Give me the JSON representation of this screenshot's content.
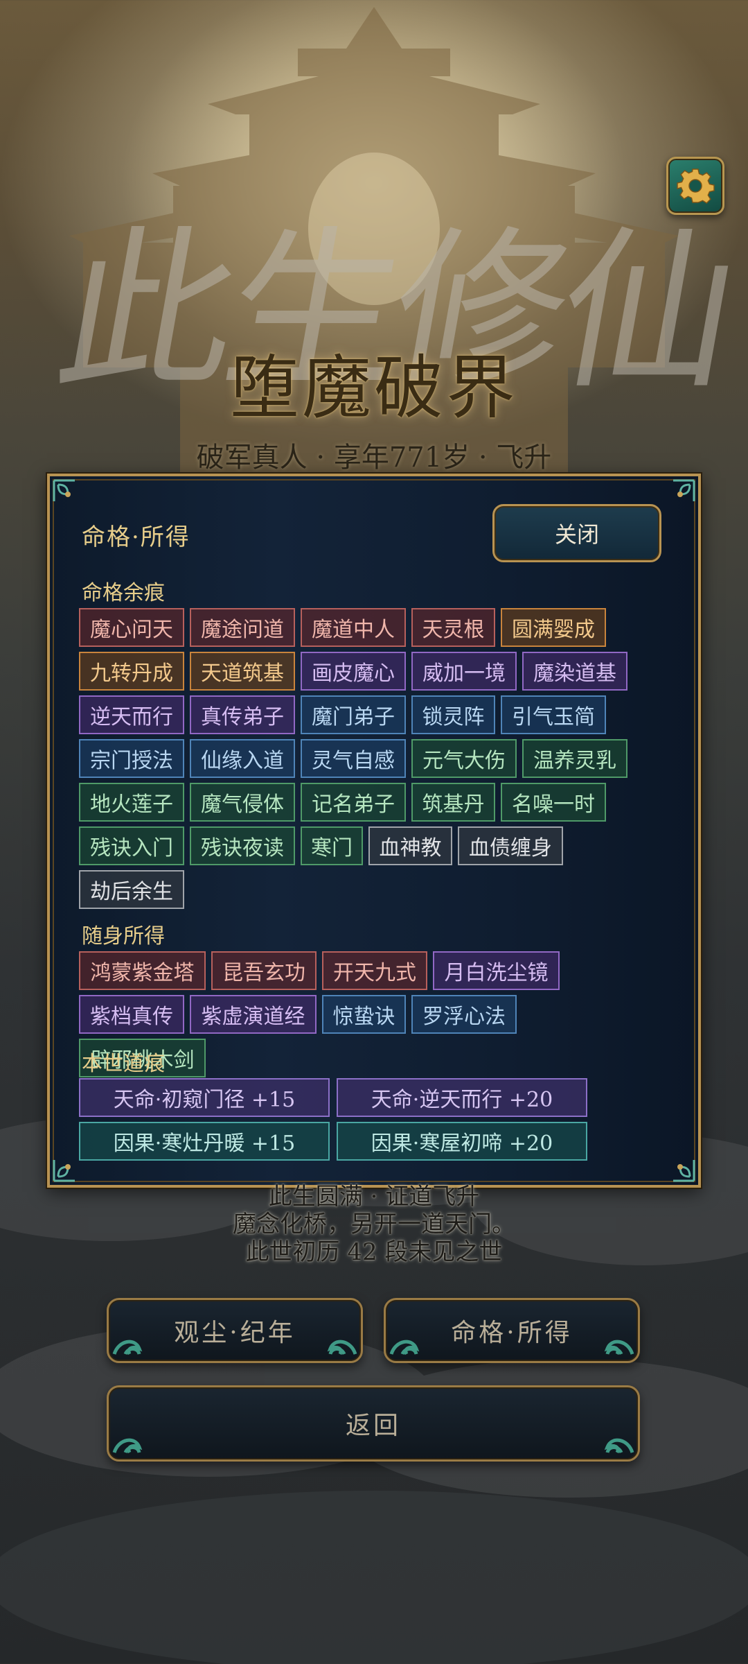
{
  "background": {
    "calligraphy": "此生修仙"
  },
  "header": {
    "title": "堕魔破界",
    "subtitle": "破军真人 · 享年771岁 · 飞升"
  },
  "panel": {
    "title": "命格·所得",
    "close_label": "关闭",
    "sections": {
      "fate_traces": {
        "label": "命格余痕",
        "tags": [
          {
            "text": "魔心问天",
            "color": "red"
          },
          {
            "text": "魔途问道",
            "color": "red"
          },
          {
            "text": "魔道中人",
            "color": "red"
          },
          {
            "text": "天灵根",
            "color": "red"
          },
          {
            "text": "圆满婴成",
            "color": "orange"
          },
          {
            "text": "九转丹成",
            "color": "orange"
          },
          {
            "text": "天道筑基",
            "color": "orange"
          },
          {
            "text": "画皮魔心",
            "color": "purple"
          },
          {
            "text": "威加一境",
            "color": "purple"
          },
          {
            "text": "魔染道基",
            "color": "purple"
          },
          {
            "text": "逆天而行",
            "color": "purple"
          },
          {
            "text": "真传弟子",
            "color": "purple"
          },
          {
            "text": "魔门弟子",
            "color": "blue"
          },
          {
            "text": "锁灵阵",
            "color": "blue"
          },
          {
            "text": "引气玉简",
            "color": "blue"
          },
          {
            "text": "宗门授法",
            "color": "blue"
          },
          {
            "text": "仙缘入道",
            "color": "blue"
          },
          {
            "text": "灵气自感",
            "color": "blue"
          },
          {
            "text": "元气大伤",
            "color": "green"
          },
          {
            "text": "温养灵乳",
            "color": "green"
          },
          {
            "text": "地火莲子",
            "color": "green"
          },
          {
            "text": "魔气侵体",
            "color": "green"
          },
          {
            "text": "记名弟子",
            "color": "green"
          },
          {
            "text": "筑基丹",
            "color": "green"
          },
          {
            "text": "名噪一时",
            "color": "green"
          },
          {
            "text": "残诀入门",
            "color": "green"
          },
          {
            "text": "残诀夜读",
            "color": "green"
          },
          {
            "text": "寒门",
            "color": "green"
          },
          {
            "text": "血神教",
            "color": "gray"
          },
          {
            "text": "血债缠身",
            "color": "gray"
          },
          {
            "text": "劫后余生",
            "color": "gray"
          }
        ]
      },
      "carried_items": {
        "label": "随身所得",
        "tags": [
          {
            "text": "鸿蒙紫金塔",
            "color": "red"
          },
          {
            "text": "昆吾玄功",
            "color": "red"
          },
          {
            "text": "开天九式",
            "color": "red"
          },
          {
            "text": "月白洗尘镜",
            "color": "purple"
          },
          {
            "text": "紫档真传",
            "color": "purple"
          },
          {
            "text": "紫虚演道经",
            "color": "purple"
          },
          {
            "text": "惊蛰诀",
            "color": "blue"
          },
          {
            "text": "罗浮心法",
            "color": "blue"
          },
          {
            "text": "辟邪桃木剑",
            "color": "green"
          }
        ]
      },
      "dao_traces": {
        "label": "本世道痕",
        "items": [
          {
            "text": "天命·初窥门径 +15",
            "color": "purple"
          },
          {
            "text": "天命·逆天而行 +20",
            "color": "purple"
          },
          {
            "text": "因果·寒灶丹暖 +15",
            "color": "teal"
          },
          {
            "text": "因果·寒屋初啼 +20",
            "color": "teal"
          }
        ]
      }
    }
  },
  "result": {
    "line1": "此生圆满 · 证道飞升",
    "line2": "魔念化桥，另开一道天门。",
    "line3": "此世初历 42 段未见之世"
  },
  "buttons": {
    "chronicle": "观尘·纪年",
    "fate_gains": "命格·所得",
    "back": "返回"
  },
  "colors": {
    "gold": "#b89352",
    "panel_bg": "#0f1d30",
    "tag_red": "#b7605c",
    "tag_orange": "#c9843c",
    "tag_purple": "#9168c4",
    "tag_blue": "#4f84b8",
    "tag_green": "#4f9a68",
    "tag_gray": "#a0a4aa"
  },
  "icons": {
    "settings": "gear-icon"
  }
}
